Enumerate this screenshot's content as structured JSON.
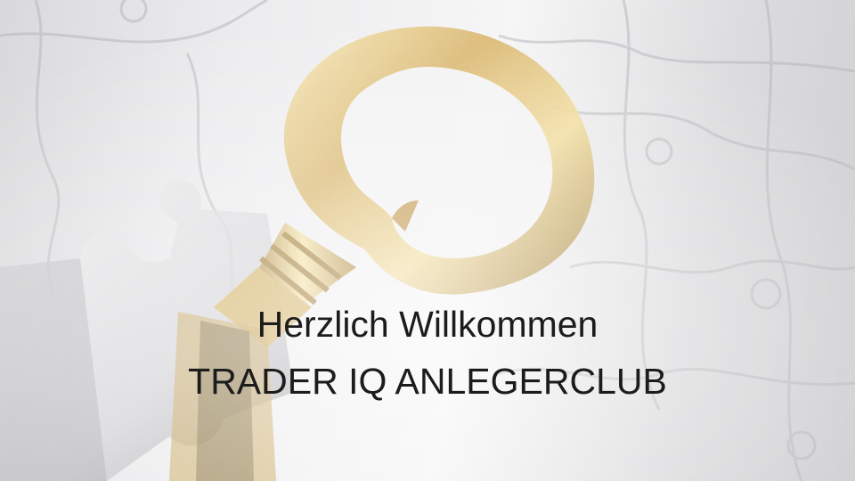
{
  "slide": {
    "title_line1": "Herzlich Willkommen",
    "title_line2": "TRADER IQ ANLEGERCLUB"
  },
  "colors": {
    "text": "#1c1c1c",
    "gold_light": "#f5e3a8",
    "gold_mid": "#cfa95a",
    "gold_dark": "#8a6a2c",
    "puzzle_light": "#f3f3f4",
    "puzzle_shadow": "#9a9aa0"
  },
  "icons": {
    "background": "golden-key-in-puzzle-icon"
  }
}
